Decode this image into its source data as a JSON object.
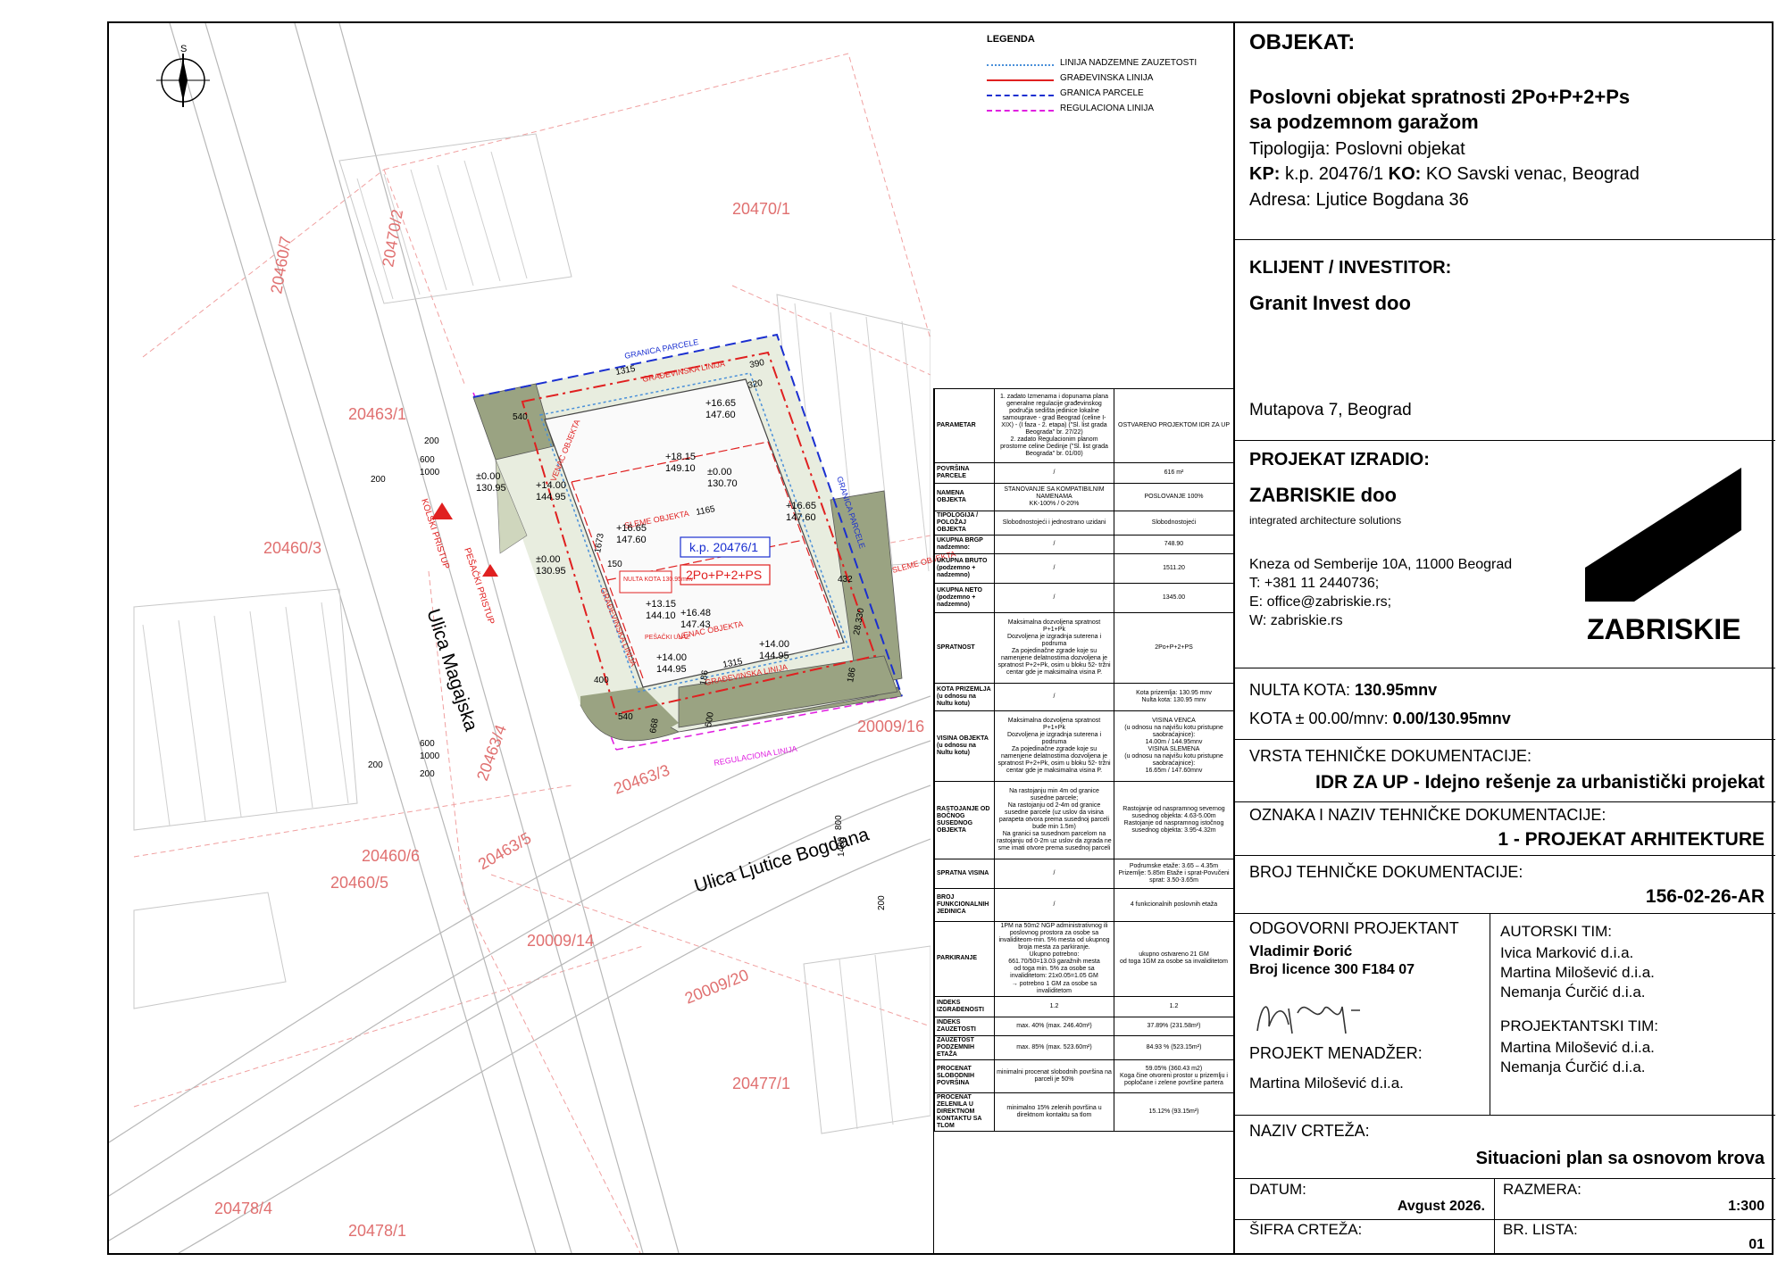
{
  "legend": {
    "title": "LEGENDA",
    "items": [
      {
        "label": "LINIJA NADZEMNE ZAUZETOSTI",
        "color": "#4a90d9",
        "style": "dotted"
      },
      {
        "label": "GRAĐEVINSKA LINIJA",
        "color": "#e02020",
        "style": "solid"
      },
      {
        "label": "GRANICA PARCELE",
        "color": "#1a2fd0",
        "style": "dashed"
      },
      {
        "label": "REGULACIONA LINIJA",
        "color": "#e020e0",
        "style": "dashed"
      }
    ]
  },
  "plan": {
    "north": "S",
    "parcels": [
      "20470/1",
      "20463/1",
      "20460/7",
      "20470/2",
      "20460/3",
      "20463/4",
      "20460/6",
      "20460/5",
      "20463/5",
      "20463/3",
      "20009/14",
      "20009/20",
      "20009/16",
      "20477/1",
      "20478/4",
      "20478/1",
      "20476/1"
    ],
    "streets": [
      "Ulica Magajska",
      "Ulica Ljutice Bogdana"
    ],
    "access": [
      "KOLSKI PRISTUP",
      "PEŠAČKI PRISTUP"
    ],
    "labels": {
      "gp_top": "GRANICA PARCELE",
      "gl_top": "GRAĐEVINSKA LINIJA",
      "venac1": "VENAC OBJEKTA",
      "sleme1": "SLEME OBJEKTA",
      "sleme2": "SLEME OBJEKTA",
      "venac2": "VENAC OBJEKTA",
      "gl_bottom": "GRAĐEVINSKA LINIJA",
      "gl_left": "GRAĐEVINSKA LINIJA",
      "gp_right": "GRANICA PARCELE",
      "nulta": "NULTA KOTA 130.95mnv",
      "kp": "k.p. 20476/1",
      "floors": "2Po+P+2+PS",
      "reg": "REGULACIONA LINIJA",
      "ulaz": "PEŠAČKI ULAZ"
    },
    "levels": [
      {
        "rel": "+16.65",
        "abs": "147.60"
      },
      {
        "rel": "+18.15",
        "abs": "149.10"
      },
      {
        "rel": "±0.00",
        "abs": "130.70"
      },
      {
        "rel": "+14.00",
        "abs": "144.95"
      },
      {
        "rel": "±0.00",
        "abs": "130.95"
      },
      {
        "rel": "+16.65",
        "abs": "147.60"
      },
      {
        "rel": "+16.65",
        "abs": "147.60"
      },
      {
        "rel": "±0.00",
        "abs": "130.95"
      },
      {
        "rel": "+13.15",
        "abs": "144.10"
      },
      {
        "rel": "+16.48",
        "abs": "147.43"
      },
      {
        "rel": "+14.00",
        "abs": "144.95"
      },
      {
        "rel": "+14.00",
        "abs": "144.95"
      }
    ],
    "dims": [
      "1315",
      "390",
      "320",
      "540",
      "600",
      "1000",
      "200",
      "200",
      "1165",
      "1673",
      "150",
      "432",
      "1315",
      "400",
      "540",
      "668",
      "500",
      "600",
      "1000",
      "200",
      "200",
      "800",
      "1400",
      "200",
      "28.330",
      "186",
      "186"
    ]
  },
  "parameters": {
    "header": {
      "col1": "PARAMETAR",
      "col2": "1. zadato Izmenama i dopunama plana generalne regulacije građevinskog područja sedišta jedinice lokalne samouprave - grad Beograd (celine I-XIX) - (I faza - 2. etapa) (\"Sl. list grada Beograda\" br. 27/22)\n2. zadato Regulacionim planom prostorne celine Dedinje (\"Sl. list grada Beograda\" br. 01/00)",
      "col3": "OSTVARENO PROJEKTOM IDR ZA UP"
    },
    "rows": [
      {
        "k": "POVRŠINA PARCELE",
        "a": "/",
        "b": "616 m²"
      },
      {
        "k": "NAMENA OBJEKTA",
        "a": "STANOVANJE SA KOMPATIBILNIM NAMENAMA\nKK-100% / 0-20%",
        "b": "POSLOVANJE 100%"
      },
      {
        "k": "TIPOLOGIJA / POLOŽAJ OBJEKTA",
        "a": "Slobodnostojeći i jednostrano uzidani",
        "b": "Slobodnostojeći"
      },
      {
        "k": "UKUPNA BRGP nadzemno:",
        "a": "/",
        "b": "748.90"
      },
      {
        "k": "UKUPNA BRUTO (podzemno + nadzemno)",
        "a": "/",
        "b": "1511.20"
      },
      {
        "k": "UKUPNA NETO (podzemno + nadzemno)",
        "a": "/",
        "b": "1345.00"
      },
      {
        "k": "SPRATNOST",
        "a": "Maksimalna dozvoljena spratnost P+1+Pk\nDozvoljena je izgradnja suterena i podruma\nZa pojedinačne zgrade koje su namenjene delatnostima dozvoljena je spratnost P+2+Pk, osim u bloku 52- tržni centar gde je maksimalna visina P.",
        "b": "2Po+P+2+PS"
      },
      {
        "k": "KOTA PRIZEMLJA (u odnosu na Nultu kotu)",
        "a": "/",
        "b": "Kota prizemlja: 130.95 mnv\nNulta kota: 130.95 mnv"
      },
      {
        "k": "VISINA OBJEKTA (u odnosu na Nultu kotu)",
        "a": "Maksimalna dozvoljena spratnost P+1+Pk\nDozvoljena je izgradnja suterena i podruma\nZa pojedinačne zgrade koje su namenjene delatnostima dozvoljena je spratnost P+2+Pk, osim u bloku 52- tržni centar gde je maksimalna visina P.",
        "b": "VISINA VENCA\n(u odnosu na najvišu kotu pristupne saobraćajnice):\n14.00m / 144.95mnv\nVISINA SLEMENA\n(u odnosu na najvišu kotu pristupne saobraćajnice):\n16.65m / 147.60mnv"
      },
      {
        "k": "RASTOJANJE OD BOČNOG SUSEDNOG OBJEKTA",
        "a": "Na rastojanju min 4m od granice susedne parcele;\nNa rastojanju od 2-4m od granice susedne parcele (uz uslov da visina parapeta otvora prema susednoj parceli bude min 1.5m)\nNa granici sa susednom parcelom na rastojanju od 0-2m uz uslov da zgrada ne sme imati otvore prema susednoj parceli",
        "b": "Rastojanje od naspramnog severnog susednog objekta: 4.63-5.00m\nRastojanje od naspramnog istočnog susednog objekta: 3.95-4.32m"
      },
      {
        "k": "SPRATNA VISINA",
        "a": "/",
        "b": "Podrumske etaže: 3.65 – 4.35m\nPrizemlje: 5.85m   Etaže i sprat-Povučeni sprat: 3.50-3.65m"
      },
      {
        "k": "BROJ FUNKCIONALNIH JEDINICA",
        "a": "/",
        "b": "4 funkcionalnih poslovnih etaža"
      },
      {
        "k": "PARKIRANJE",
        "a": "1PM na 50m2 NGP administrativnog ili poslovnog prostora                za osobe sa invaliditeom-min. 5% mesta od ukupnog broja mesta za parkiranje.\nUkupno potrebno:\n661.70/50=13.03 garažnih mesta\nod toga min. 5% za osobe sa invaliditetom: 21x0.05=1.05 GM\n→ potrebno 1 GM za osobe sa invaliditetom",
        "b": "ukupno ostvareno 21 GM\nod toga 1GM za osobe sa invaliditetom"
      },
      {
        "k": "INDEKS IZGRAĐENOSTI",
        "a": "1.2",
        "b": "1.2"
      },
      {
        "k": "INDEKS ZAUZETOSTI",
        "a": "max. 40% (max. 246.40m²)",
        "b": "37.89% (231.58m²)"
      },
      {
        "k": "ZAUZETOST PODZEMNIH ETAŽA",
        "a": "max. 85% (max. 523.60m²)",
        "b": "84.93 % (523.15m²)"
      },
      {
        "k": "PROCENAT SLOBODNIH POVRŠINA",
        "a": "minimalni procenat slobodnih površina na parceli je 50%",
        "b": "59.05% (360.43 m2)\nKoga čine otvoreni prostor u prizemlju i popločane i zelene površine partera"
      },
      {
        "k": "PROCENAT ZELENILA U DIREKTNOM KONTAKTU SA TLOM",
        "a": "minimalno 15% zelenih površina u direktnom kontaktu sa tlom",
        "b": "15.12% (93.15m²)"
      }
    ]
  },
  "titleblock": {
    "objekat_label": "OBJEKAT:",
    "objekat_line1": "Poslovni objekat spratnosti 2Po+P+2+Ps",
    "objekat_line2": "sa podzemnom garažom",
    "tipologija_label": "Tipologija:",
    "tipologija": "Poslovni objekat",
    "kp_label": "KP:",
    "kp": "k.p. 20476/1",
    "ko_label": "KO:",
    "ko": "KO Savski venac, Beograd",
    "adresa_label": "Adresa:",
    "adresa": "Ljutice Bogdana 36",
    "klijent_label": "KLIJENT / INVESTITOR:",
    "klijent": "Granit Invest doo",
    "klijent_adresa": "Mutapova 7, Beograd",
    "izradio_label": "PROJEKAT IZRADIO:",
    "firma": "ZABRISKIE doo",
    "firma_sub": "integrated architecture solutions",
    "firma_adresa": "Kneza od Semberije 10A, 11000 Beograd",
    "tel": "T: +381 11 2440736;",
    "email": "E: office@zabriskie.rs;",
    "web": "W: zabriskie.rs",
    "logo_text": "ZABRISKIE",
    "nulta_label": "NULTA KOTA:",
    "nulta": "130.95mnv",
    "kota_label": "KOTA ± 00.00/mnv:",
    "kota": "0.00/130.95mnv",
    "vrsta_label": "VRSTA TEHNIČKE DOKUMENTACIJE:",
    "vrsta": "IDR ZA UP - Idejno rešenje za urbanistički projekat",
    "oznaka_label": "OZNAKA I NAZIV TEHNIČKE DOKUMENTACIJE:",
    "oznaka": "1 - PROJEKAT ARHITEKTURE",
    "broj_label": "BROJ TEHNIČKE DOKUMENTACIJE:",
    "broj": "156-02-26-AR",
    "odg_label": "ODGOVORNI PROJEKTANT",
    "odg_ime": "Vladimir Đorić",
    "licenca": "Broj licence 300 F184 07",
    "autorski_label": "AUTORSKI TIM:",
    "autorski": [
      "Ivica Marković d.i.a.",
      "Martina Milošević d.i.a.",
      "Nemanja Ćurčić d.i.a."
    ],
    "projektantski_label": "PROJEKTANTSKI TIM:",
    "projektantski": [
      "Martina Milošević d.i.a.",
      "Nemanja Ćurčić d.i.a."
    ],
    "menadzer_label": "PROJEKT MENADŽER:",
    "menadzer": "Martina Milošević d.i.a.",
    "naziv_label": "NAZIV CRTEŽA:",
    "naziv": "Situacioni plan sa osnovom krova",
    "datum_label": "DATUM:",
    "datum": "Avgust 2026.",
    "razmera_label": "RAZMERA:",
    "razmera": "1:300",
    "sifra_label": "ŠIFRA CRTEŽA:",
    "sifra": "",
    "list_label": "BR. LISTA:",
    "list": "01"
  }
}
